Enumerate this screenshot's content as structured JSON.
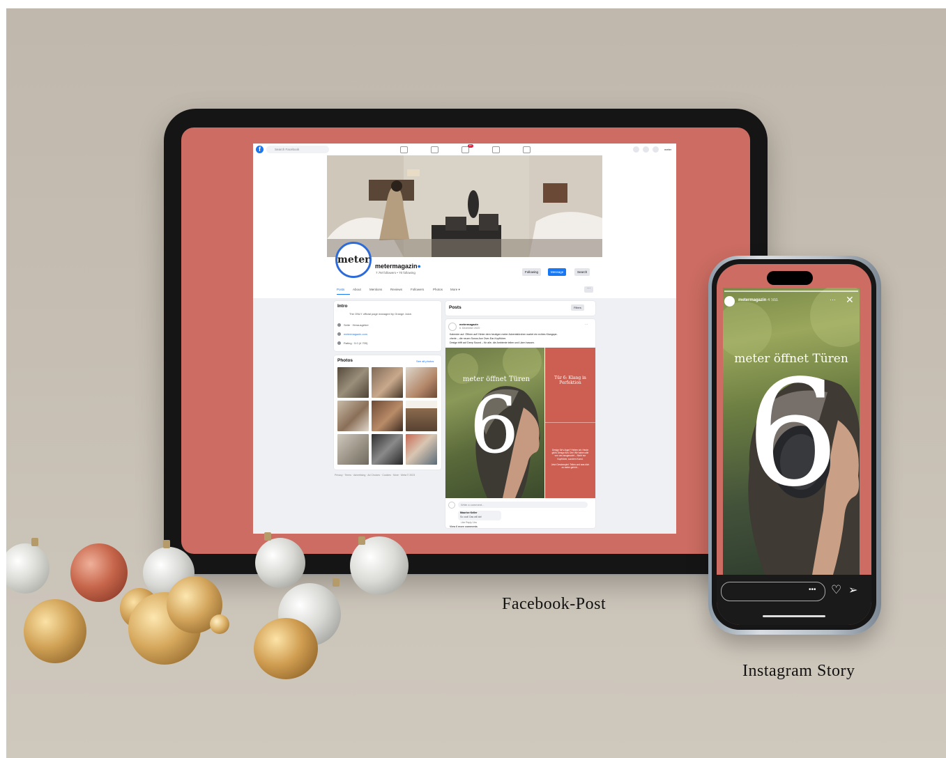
{
  "captions": {
    "facebook": "Facebook-Post",
    "instagram": "Instagram Story"
  },
  "facebook_ui": {
    "search_placeholder": "Search Facebook",
    "notification_badge": "9+",
    "account_name": "meter",
    "page_name": "metermagazin",
    "followers": "7.7M followers • 70 following",
    "avatar_text": "meter",
    "buttons": {
      "following": "Following",
      "message": "Message",
      "search": "Search"
    },
    "tabs": [
      "Posts",
      "About",
      "Mentions",
      "Reviews",
      "Followers",
      "Photos",
      "More ▾"
    ],
    "intro": {
      "heading": "Intro",
      "description": "The ONLY official page managed by Orange Juice.",
      "page_type": "Seite · Herausgeber",
      "website": "metermagazin.com",
      "rating": "Rating · 5.0 (4 705)"
    },
    "photos": {
      "heading": "Photos",
      "see_all": "See all photos"
    },
    "legal": "Privacy · Terms · Advertising · Ad Choices · Cookies · More · Meta © 2023",
    "posts": {
      "heading": "Posts",
      "filters": "Filters"
    },
    "post": {
      "author": "metermagazin",
      "date": "6. Dezember 2023 ·",
      "text_line1": "Kalender auf. Öffnen auf! Hinter dem heutigen meter Adventstürchen wartet ein echtes Klangspe-",
      "text_line2": "zherle – die neuen Sonos Ace Over-Ear-Kopfhörer.",
      "text_line3": "Design trifft auf Deep Sound – für alle, die Ambiente teilen und Lärm hassen.",
      "image_headline": "meter öffnet Türen",
      "image_number": "6",
      "door_title": "Tür 6: Klang in Perfektion",
      "door_body": "Design für's Auge? Heben wir. Heute gibt's Design fürs Ohr! Wir haben alle von uns ausgesucht – Nicht nur Kopfhörer, sondern Kunst.",
      "door_body2": "Jetzt Gewinnspiel: Teilen und was dich zu meter gehört...",
      "comment_placeholder": "Write a comment...",
      "commenter": "Maurice Keller",
      "comment_text": "So cool! Das will ich!",
      "comment_actions": "Like   Reply   14w",
      "view_more": "View 6 more comments"
    }
  },
  "instagram_ui": {
    "username": "metermagazin",
    "time": "4 Std.",
    "headline": "meter öffnet Türen",
    "number": "6"
  }
}
